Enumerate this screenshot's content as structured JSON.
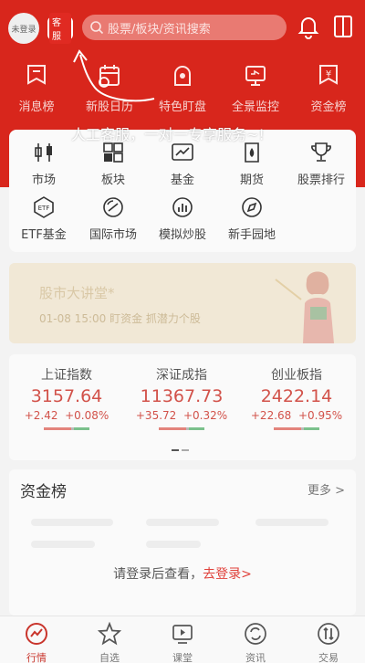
{
  "topbar": {
    "avatar_label": "未登录",
    "kefu_label": "客服",
    "search_placeholder": "股票/板块/资讯搜索"
  },
  "quick_links": [
    {
      "label": "消息榜",
      "icon": "message-rank-icon"
    },
    {
      "label": "新股日历",
      "icon": "calendar-icon"
    },
    {
      "label": "特色盯盘",
      "icon": "watch-market-icon"
    },
    {
      "label": "全景监控",
      "icon": "monitor-icon"
    },
    {
      "label": "资金榜",
      "icon": "money-rank-icon"
    }
  ],
  "grid_items": [
    {
      "label": "市场",
      "icon": "candlestick-icon"
    },
    {
      "label": "板块",
      "icon": "sector-icon"
    },
    {
      "label": "基金",
      "icon": "fund-icon"
    },
    {
      "label": "期货",
      "icon": "futures-icon"
    },
    {
      "label": "股票排行",
      "icon": "trophy-icon"
    },
    {
      "label": "ETF基金",
      "icon": "etf-icon"
    },
    {
      "label": "国际市场",
      "icon": "global-market-icon"
    },
    {
      "label": "模拟炒股",
      "icon": "simulate-trade-icon"
    },
    {
      "label": "新手园地",
      "icon": "compass-icon"
    }
  ],
  "banner": {
    "title": "股市大讲堂*",
    "subtitle": "01-08 15:00 盯资金 抓潜力个股"
  },
  "indices": [
    {
      "name": "上证指数",
      "value": "3157.64",
      "change": "+2.42",
      "pct": "+0.08%"
    },
    {
      "name": "深证成指",
      "value": "11367.73",
      "change": "+35.72",
      "pct": "+0.32%"
    },
    {
      "name": "创业板指",
      "value": "2422.14",
      "change": "+22.68",
      "pct": "+0.95%"
    }
  ],
  "fund_rank": {
    "title": "资金榜",
    "more": "更多 >",
    "login_prompt": "请登录后查看，",
    "login_link": "去登录>"
  },
  "tabs": [
    {
      "label": "行情",
      "icon": "market-icon",
      "active": true
    },
    {
      "label": "自选",
      "icon": "star-icon",
      "active": false
    },
    {
      "label": "课堂",
      "icon": "classroom-icon",
      "active": false
    },
    {
      "label": "资讯",
      "icon": "news-icon",
      "active": false
    },
    {
      "label": "交易",
      "icon": "trade-icon",
      "active": false
    }
  ],
  "tooltip": "人工客服，一对一专享服务~!",
  "colors": {
    "brand_red": "#d8261c",
    "rise": "#d2524a",
    "fall": "#7bc18c"
  }
}
